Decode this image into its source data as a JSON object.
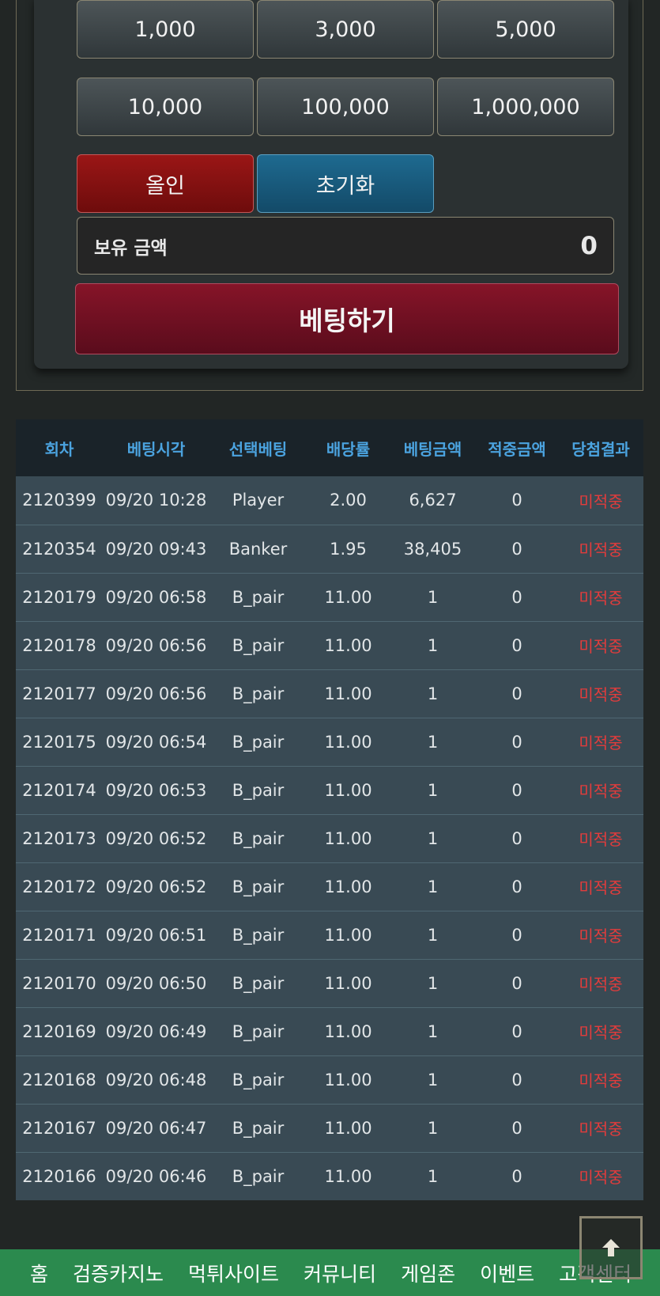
{
  "chips": [
    "1,000",
    "3,000",
    "5,000",
    "10,000",
    "100,000",
    "1,000,000"
  ],
  "actions": {
    "allin_label": "올인",
    "reset_label": "초기화"
  },
  "balance": {
    "label": "보유 금액",
    "value": "0"
  },
  "bet_button_label": "베팅하기",
  "history": {
    "columns": [
      "회차",
      "베팅시각",
      "선택베팅",
      "배당률",
      "베팅금액",
      "적중금액",
      "당첨결과"
    ],
    "rows": [
      [
        "2120399",
        "09/20 10:28",
        "Player",
        "2.00",
        "6,627",
        "0",
        "미적중"
      ],
      [
        "2120354",
        "09/20 09:43",
        "Banker",
        "1.95",
        "38,405",
        "0",
        "미적중"
      ],
      [
        "2120179",
        "09/20 06:58",
        "B_pair",
        "11.00",
        "1",
        "0",
        "미적중"
      ],
      [
        "2120178",
        "09/20 06:56",
        "B_pair",
        "11.00",
        "1",
        "0",
        "미적중"
      ],
      [
        "2120177",
        "09/20 06:56",
        "B_pair",
        "11.00",
        "1",
        "0",
        "미적중"
      ],
      [
        "2120175",
        "09/20 06:54",
        "B_pair",
        "11.00",
        "1",
        "0",
        "미적중"
      ],
      [
        "2120174",
        "09/20 06:53",
        "B_pair",
        "11.00",
        "1",
        "0",
        "미적중"
      ],
      [
        "2120173",
        "09/20 06:52",
        "B_pair",
        "11.00",
        "1",
        "0",
        "미적중"
      ],
      [
        "2120172",
        "09/20 06:52",
        "B_pair",
        "11.00",
        "1",
        "0",
        "미적중"
      ],
      [
        "2120171",
        "09/20 06:51",
        "B_pair",
        "11.00",
        "1",
        "0",
        "미적중"
      ],
      [
        "2120170",
        "09/20 06:50",
        "B_pair",
        "11.00",
        "1",
        "0",
        "미적중"
      ],
      [
        "2120169",
        "09/20 06:49",
        "B_pair",
        "11.00",
        "1",
        "0",
        "미적중"
      ],
      [
        "2120168",
        "09/20 06:48",
        "B_pair",
        "11.00",
        "1",
        "0",
        "미적중"
      ],
      [
        "2120167",
        "09/20 06:47",
        "B_pair",
        "11.00",
        "1",
        "0",
        "미적중"
      ],
      [
        "2120166",
        "09/20 06:46",
        "B_pair",
        "11.00",
        "1",
        "0",
        "미적중"
      ]
    ]
  },
  "bottom_nav": [
    "홈",
    "검증카지노",
    "먹튀사이트",
    "커뮤니티",
    "게임존",
    "이벤트",
    "고객센터"
  ],
  "icons": {
    "scroll_top": "arrow-up-icon"
  },
  "colors": {
    "allin": "#8a1212",
    "reset": "#175d82",
    "bet_button": "#741124",
    "header_text": "#4ba3df",
    "result_text": "#e23c3c",
    "nav_bg": "#2b8a4e"
  }
}
